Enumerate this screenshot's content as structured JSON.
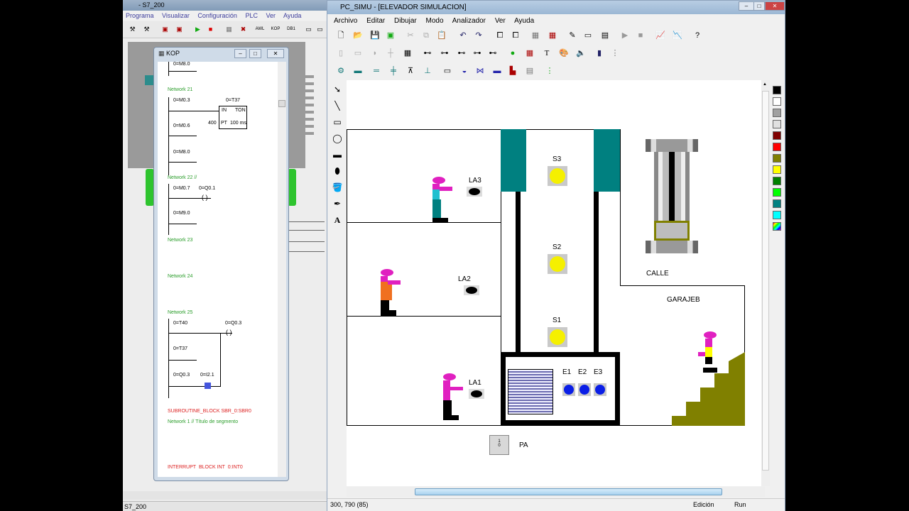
{
  "s7": {
    "title": "- S7_200",
    "menu": [
      "Programa",
      "Visualizar",
      "Configuración",
      "PLC",
      "Ver",
      "Ayuda"
    ],
    "toolbar": [
      "AWL",
      "KOP",
      "DB1"
    ],
    "status": "S7_200"
  },
  "kop": {
    "title": "KOP",
    "lines": [
      {
        "t": "0=M8.0",
        "c": "contact"
      },
      {
        "t": "Network 21",
        "c": "net"
      },
      {
        "t": "0=M0.3",
        "c": "contact"
      },
      {
        "t": "0=T37",
        "c": "coil"
      },
      {
        "t": "IN",
        "c": "box"
      },
      {
        "t": "TON",
        "c": "box"
      },
      {
        "t": "400",
        "c": "box"
      },
      {
        "t": "PT",
        "c": "box"
      },
      {
        "t": "100 ms",
        "c": "box"
      },
      {
        "t": "0=M0.6",
        "c": "contact"
      },
      {
        "t": "0=M8.0",
        "c": "contact"
      },
      {
        "t": "Network 22 //",
        "c": "net"
      },
      {
        "t": "0=M0.7",
        "c": "contact"
      },
      {
        "t": "0=Q0.1",
        "c": "coil"
      },
      {
        "t": "0=M9.0",
        "c": "contact"
      },
      {
        "t": "Network 23",
        "c": "net"
      },
      {
        "t": "Network 24",
        "c": "net"
      },
      {
        "t": "Network 25",
        "c": "net"
      },
      {
        "t": "0=T40",
        "c": "contact"
      },
      {
        "t": "0=Q0.3",
        "c": "coil"
      },
      {
        "t": "0=T37",
        "c": "contact"
      },
      {
        "t": "0=Q0.3",
        "c": "contact"
      },
      {
        "t": "0=I2.1",
        "c": "contact"
      },
      {
        "t": "SUBROUTINE_BLOCK SBR_0:SBR0",
        "c": "red"
      },
      {
        "t": "Network 1 // Título de segmento",
        "c": "net"
      },
      {
        "t": "INTERRUPT_BLOCK INT_0:INT0",
        "c": "red"
      }
    ]
  },
  "pc": {
    "title": "PC_SIMU - [ELEVADOR SIMULACION]",
    "menu": [
      "Archivo",
      "Editar",
      "Dibujar",
      "Modo",
      "Analizador",
      "Ver",
      "Ayuda"
    ],
    "palette": [
      "#000000",
      "#ffffff",
      "#a0a0a0",
      "#e0e0e0",
      "#800000",
      "#ff0000",
      "#808000",
      "#ffff00",
      "#008000",
      "#00ff00",
      "#008080",
      "#00ffff",
      "rainbow"
    ],
    "status": {
      "coords": "300, 790 (85)",
      "mode": "Edición",
      "run": "Run"
    }
  },
  "scene": {
    "sensors": [
      "S3",
      "S2",
      "S1"
    ],
    "lamps": [
      "LA3",
      "LA2",
      "LA1"
    ],
    "floor_buttons": [
      "E1",
      "E2",
      "E3"
    ],
    "calle": "CALLE",
    "garaje": "GARAJEB",
    "pa": "PA",
    "switch_text": [
      "1",
      "0"
    ]
  },
  "colors": {
    "teal": "#008080",
    "olive": "#808000",
    "sensor_yellow": "#f5f000",
    "button_blue": "#0a1ee6",
    "ladder_green": "#2a9d2a",
    "ladder_red": "#d22"
  }
}
